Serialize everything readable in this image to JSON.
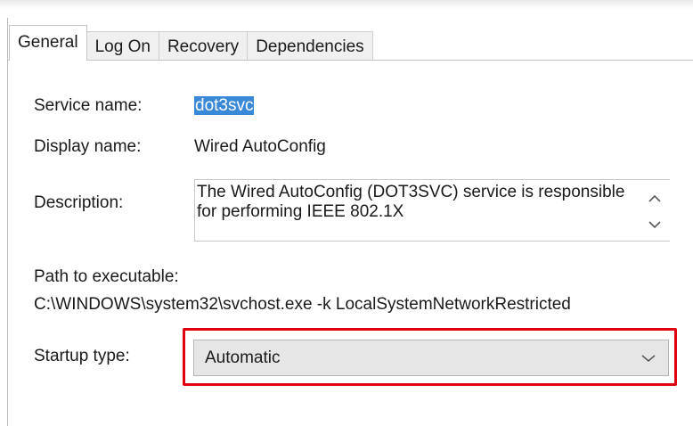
{
  "tabs": [
    {
      "label": "General",
      "active": true
    },
    {
      "label": "Log On",
      "active": false
    },
    {
      "label": "Recovery",
      "active": false
    },
    {
      "label": "Dependencies",
      "active": false
    }
  ],
  "general": {
    "service_name_label": "Service name:",
    "service_name_value": "dot3svc",
    "display_name_label": "Display name:",
    "display_name_value": "Wired AutoConfig",
    "description_label": "Description:",
    "description_value": "The Wired AutoConfig (DOT3SVC) service is responsible for performing IEEE 802.1X",
    "path_label": "Path to executable:",
    "path_value": "C:\\WINDOWS\\system32\\svchost.exe -k LocalSystemNetworkRestricted",
    "startup_type_label": "Startup type:",
    "startup_type_value": "Automatic"
  },
  "colors": {
    "selection": "#3a88d8",
    "highlight": "#e0000f",
    "tab_bg": "#f0f0f0",
    "select_bg": "#e6e6e6"
  },
  "icons": {
    "scroll_up": "chevron-up-icon",
    "scroll_down": "chevron-down-icon",
    "dropdown": "chevron-down-icon"
  }
}
